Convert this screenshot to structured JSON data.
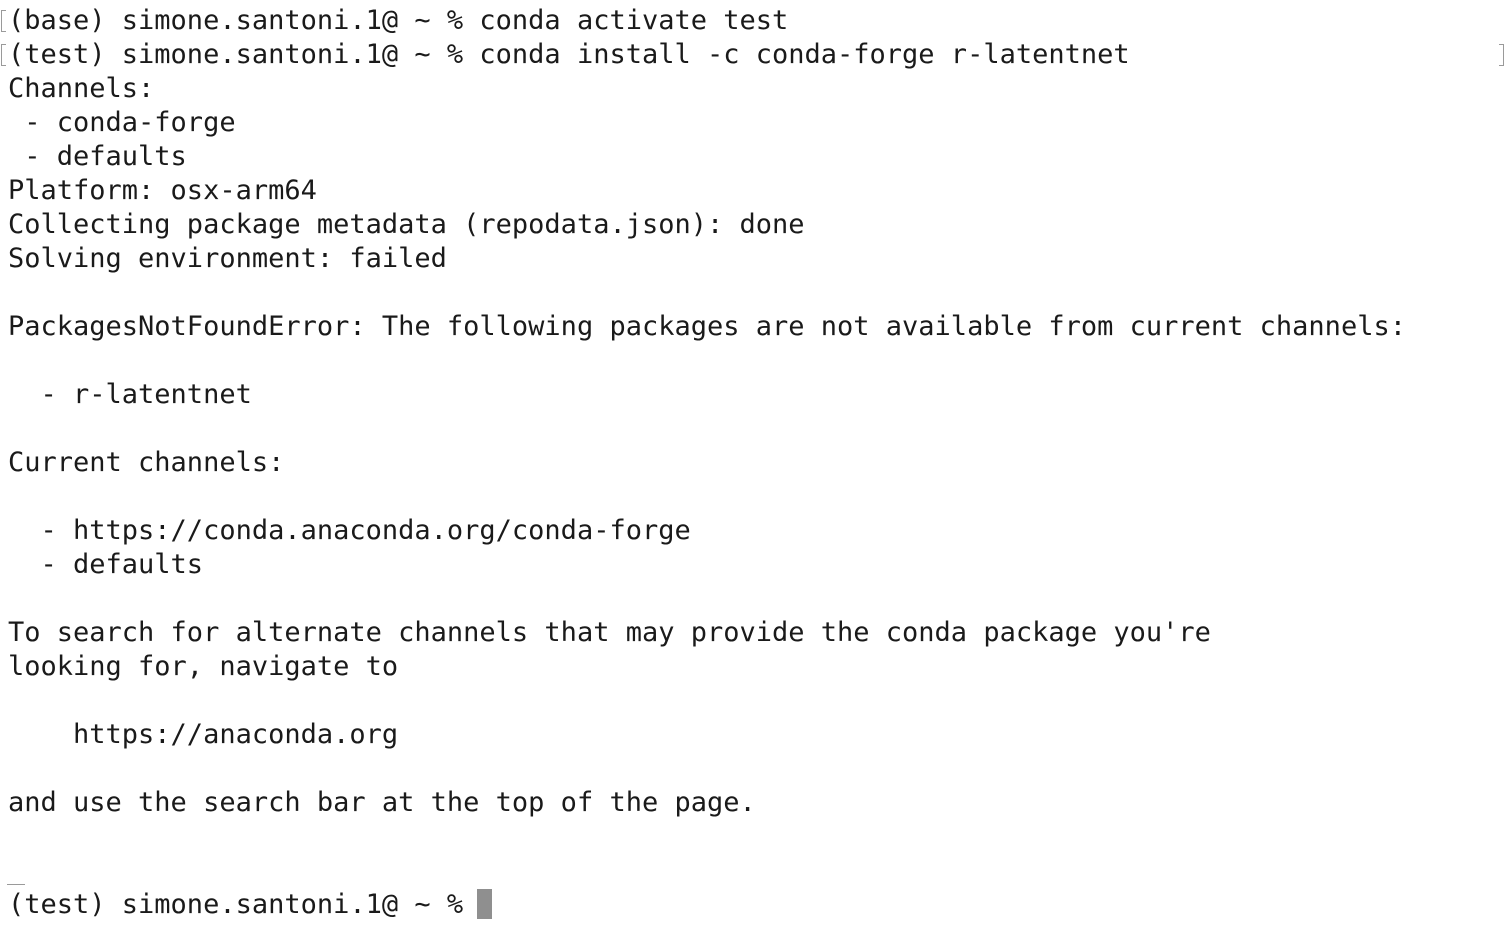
{
  "terminal": {
    "lines": [
      "(base) simone.santoni.1@ ~ % conda activate test",
      "(test) simone.santoni.1@ ~ % conda install -c conda-forge r-latentnet",
      "Channels:",
      " - conda-forge",
      " - defaults",
      "Platform: osx-arm64",
      "Collecting package metadata (repodata.json): done",
      "Solving environment: failed",
      "",
      "PackagesNotFoundError: The following packages are not available from current channels:",
      "",
      "  - r-latentnet",
      "",
      "Current channels:",
      "",
      "  - https://conda.anaconda.org/conda-forge",
      "  - defaults",
      "",
      "To search for alternate channels that may provide the conda package you're",
      "looking for, navigate to",
      "",
      "    https://anaconda.org",
      "",
      "and use the search bar at the top of the page."
    ],
    "prompt": "(test) simone.santoni.1@ ~ %",
    "colors": {
      "background": "#ffffff",
      "text": "#1a1a1a",
      "cursor": "#8f8f8f",
      "marks": "#9a9a9a"
    }
  }
}
